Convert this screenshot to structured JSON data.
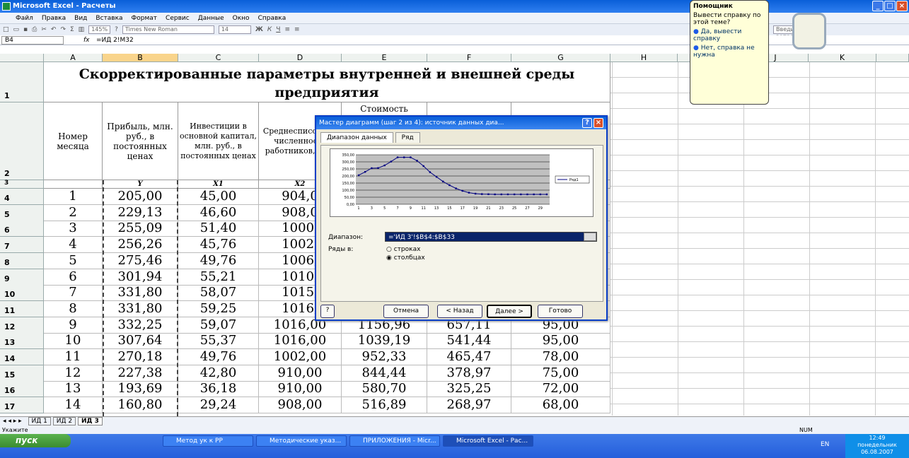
{
  "window": {
    "title": "Microsoft Excel - Расчеты",
    "buttons": [
      "_",
      "□",
      "×"
    ]
  },
  "menu": [
    "Файл",
    "Правка",
    "Вид",
    "Вставка",
    "Формат",
    "Сервис",
    "Данные",
    "Окно",
    "Справка"
  ],
  "toolbar": {
    "zoom": "145%",
    "font": "Times New Roman",
    "size": "14",
    "question_input": "Введите вопрос"
  },
  "formula": {
    "namebox": "B4",
    "fx": "fx",
    "value": "=ИД 2!M32"
  },
  "columns": [
    "A",
    "B",
    "C",
    "D",
    "E",
    "F",
    "G",
    "H",
    "I",
    "J",
    "K"
  ],
  "row_numbers": [
    "1",
    "2",
    "3",
    "4",
    "5",
    "6",
    "7",
    "8",
    "9",
    "10",
    "11",
    "12",
    "13",
    "14",
    "15",
    "16",
    "17"
  ],
  "sheet_title": "Скорректированные параметры внутренней и внешней среды предприятия",
  "headers": {
    "a": "Номер месяца",
    "b": "Прибыль, млн. руб., в постоянных ценах",
    "c": "Инвестиции в основной капитал, млн. руб., в постоянных ценах",
    "d": "Среднесписочная численность работников, чел.",
    "e": "Стоимость"
  },
  "row3": {
    "b": "Y",
    "c": "X1",
    "d": "X2"
  },
  "rows": [
    [
      "1",
      "205,00",
      "45,00",
      "904,0",
      "",
      "",
      ""
    ],
    [
      "2",
      "229,13",
      "46,60",
      "908,0",
      "",
      "",
      ""
    ],
    [
      "3",
      "255,09",
      "51,40",
      "1000,",
      "",
      "",
      ""
    ],
    [
      "4",
      "256,26",
      "45,76",
      "1002,",
      "",
      "",
      ""
    ],
    [
      "5",
      "275,46",
      "49,76",
      "1006,",
      "",
      "",
      ""
    ],
    [
      "6",
      "301,94",
      "55,21",
      "1010,",
      "",
      "",
      ""
    ],
    [
      "7",
      "331,80",
      "58,07",
      "1015,",
      "",
      "",
      ""
    ],
    [
      "8",
      "331,80",
      "59,25",
      "1016,",
      "",
      "",
      ""
    ],
    [
      "9",
      "332,25",
      "59,07",
      "1016,00",
      "1156,96",
      "657,11",
      "95,00"
    ],
    [
      "10",
      "307,64",
      "55,37",
      "1016,00",
      "1039,19",
      "541,44",
      "95,00"
    ],
    [
      "11",
      "270,18",
      "49,76",
      "1002,00",
      "952,33",
      "465,47",
      "78,00"
    ],
    [
      "12",
      "227,38",
      "42,80",
      "910,00",
      "844,44",
      "378,97",
      "75,00"
    ],
    [
      "13",
      "193,69",
      "36,18",
      "910,00",
      "580,70",
      "325,25",
      "72,00"
    ],
    [
      "14",
      "160,80",
      "29,24",
      "908,00",
      "516,89",
      "268,97",
      "68,00"
    ]
  ],
  "dialog": {
    "title": "Мастер диаграмм (шаг 2 из 4): источник данных диа...",
    "tabs": [
      "Диапазон данных",
      "Ряд"
    ],
    "range_label": "Диапазон:",
    "range_value": "='ИД 3'!$B$4:$B$33",
    "series_in_label": "Ряды в:",
    "option_rows": "строках",
    "option_cols": "столбцах",
    "legend": "Ряд1",
    "buttons": {
      "cancel": "Отмена",
      "back": "< Назад",
      "next": "Далее >",
      "finish": "Готово"
    }
  },
  "chart_data": {
    "type": "line",
    "x": [
      1,
      2,
      3,
      4,
      5,
      6,
      7,
      8,
      9,
      10,
      11,
      12,
      13,
      14,
      15,
      16,
      17,
      18,
      19,
      20,
      21,
      22,
      23,
      24,
      25,
      26,
      27,
      28,
      29,
      30
    ],
    "series": [
      {
        "name": "Ряд1",
        "values": [
          205,
          229,
          255,
          256,
          275,
          302,
          332,
          332,
          332,
          308,
          270,
          227,
          194,
          161,
          135,
          112,
          95,
          82,
          75,
          72,
          71,
          70,
          70,
          70,
          70,
          70,
          70,
          70,
          70,
          70
        ]
      }
    ],
    "ylim": [
      0,
      350
    ],
    "yticks": [
      "350,00",
      "300,00",
      "250,00",
      "200,00",
      "150,00",
      "100,00",
      "50,00",
      "0,00"
    ],
    "xticks": [
      "1",
      "3",
      "5",
      "7",
      "9",
      "11",
      "13",
      "15",
      "17",
      "19",
      "21",
      "23",
      "25",
      "27",
      "29"
    ],
    "legend_position": "right"
  },
  "assistant": {
    "title": "Помощник",
    "text": "Вывести справку по этой теме?",
    "opt1": "Да, вывести справку",
    "opt2": "Нет, справка не нужна"
  },
  "sheets": [
    "ИД 1",
    "ИД 2",
    "ИД 3"
  ],
  "status": {
    "left": "Укажите",
    "right": "NUM"
  },
  "taskbar": {
    "start": "пуск",
    "tasks": [
      "Метод ук к РР",
      "Методические указ...",
      "ПРИЛОЖЕНИЯ - Micr...",
      "Microsoft Excel - Рас..."
    ],
    "lang": "EN",
    "time": "12:49",
    "day": "понедельник",
    "date": "06.08.2007"
  },
  "colors": {
    "title": "#0a5fd8",
    "taskbar": "#245edb"
  }
}
